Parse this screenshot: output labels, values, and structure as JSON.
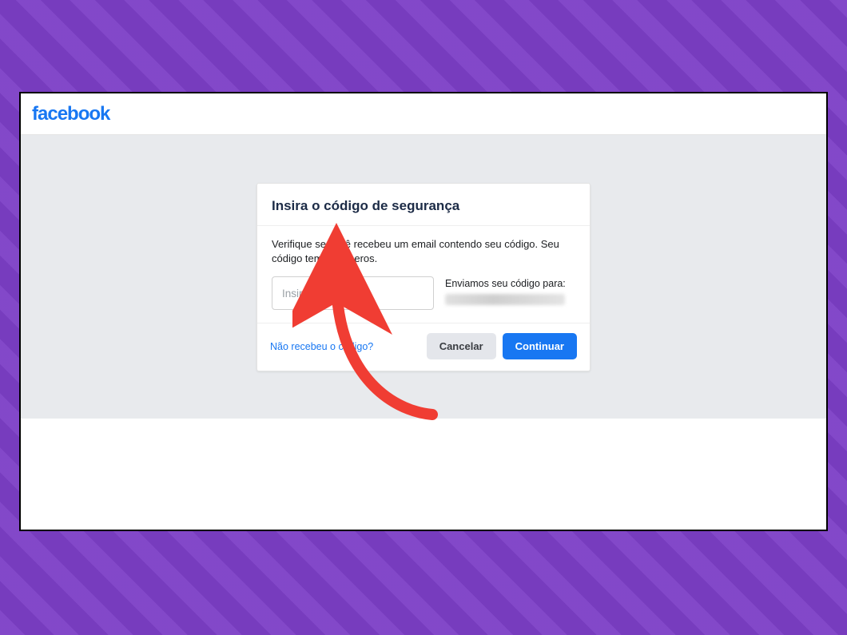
{
  "header": {
    "logo_text": "facebook"
  },
  "modal": {
    "title": "Insira o código de segurança",
    "description": "Verifique se você recebeu um email contendo seu código. Seu código tem 6 números.",
    "input_placeholder": "Insira o código",
    "sent_to_label": "Enviamos seu código para:",
    "help_link_text": "Não recebeu o código?",
    "cancel_label": "Cancelar",
    "continue_label": "Continuar"
  },
  "annotation": {
    "arrow_color": "#f03d33"
  }
}
